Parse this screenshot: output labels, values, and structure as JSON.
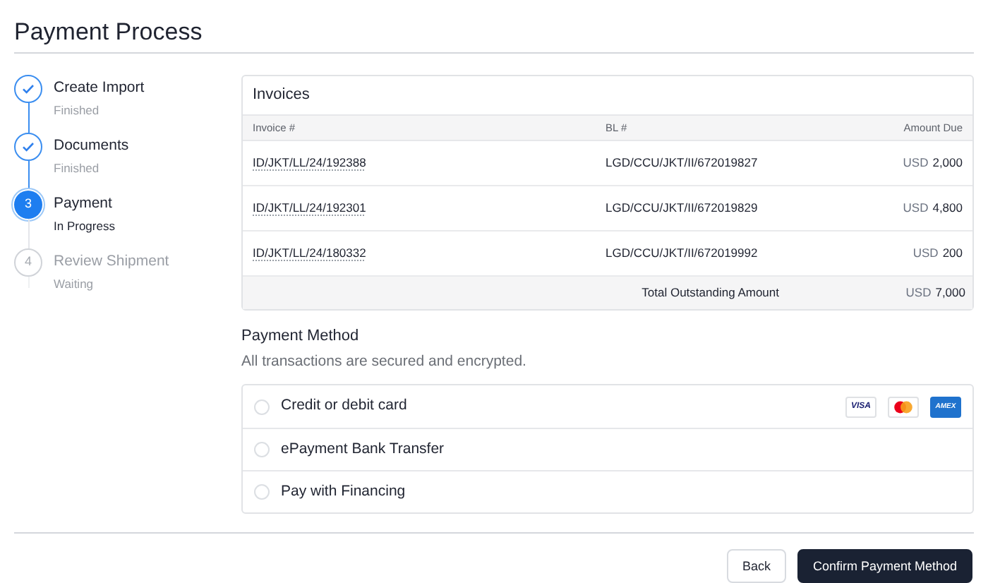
{
  "page_title": "Payment Process",
  "steps": [
    {
      "title": "Create Import",
      "status": "Finished",
      "kind": "finished"
    },
    {
      "title": "Documents",
      "status": "Finished",
      "kind": "finished"
    },
    {
      "title": "Payment",
      "status": "In Progress",
      "kind": "current",
      "number": "3"
    },
    {
      "title": "Review Shipment",
      "status": "Waiting",
      "kind": "waiting",
      "number": "4"
    }
  ],
  "invoices": {
    "title": "Invoices",
    "columns": [
      "Invoice #",
      "BL #",
      "Amount Due"
    ],
    "rows": [
      {
        "invoice": "ID/JKT/LL/24/192388",
        "bl": "LGD/CCU/JKT/II/672019827",
        "currency": "USD",
        "amount": "2,000"
      },
      {
        "invoice": "ID/JKT/LL/24/192301",
        "bl": "LGD/CCU/JKT/II/672019829",
        "currency": "USD",
        "amount": "4,800"
      },
      {
        "invoice": "ID/JKT/LL/24/180332",
        "bl": "LGD/CCU/JKT/II/672019992",
        "currency": "USD",
        "amount": "200"
      }
    ],
    "total": {
      "label": "Total Outstanding Amount",
      "currency": "USD",
      "amount": "7,000"
    }
  },
  "payment_method": {
    "title": "Payment Method",
    "subtitle": "All transactions are secured and encrypted.",
    "options": [
      {
        "label": "Credit or debit card",
        "selected": false,
        "cards": [
          {
            "kind": "visa",
            "label": "VISA"
          },
          {
            "kind": "mastercard"
          },
          {
            "kind": "amex",
            "label": "AMEX"
          }
        ]
      },
      {
        "label": "ePayment Bank Transfer",
        "selected": false
      },
      {
        "label": "Pay with Financing",
        "selected": false
      }
    ]
  },
  "buttons": [
    {
      "label": "Back",
      "kind": "secondary"
    },
    {
      "label": "Confirm Payment Method",
      "kind": "primary"
    }
  ]
}
